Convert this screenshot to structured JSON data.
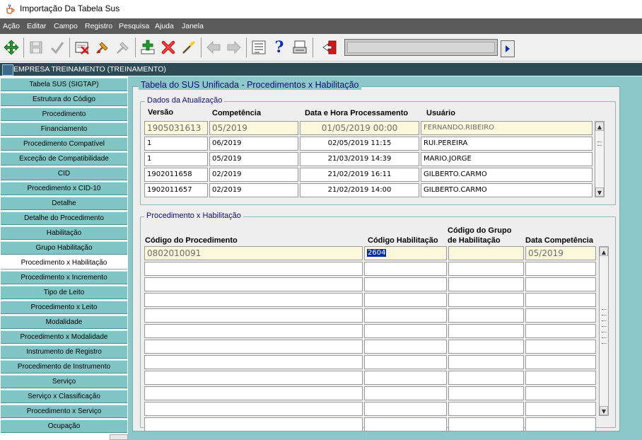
{
  "window": {
    "title": "Importação Da Tabela Sus"
  },
  "menu": [
    "Ação",
    "Editar",
    "Campo",
    "Registro",
    "Pesquisa",
    "Ajuda",
    "Janela"
  ],
  "toolbar": {
    "icons": [
      "enter-query-icon",
      "save-icon",
      "accept-icon",
      "print-icon",
      "clear-icon",
      "clear-field-icon",
      "insert-record-icon",
      "delete-record-icon",
      "duplicate-icon",
      "previous-icon",
      "next-icon",
      "list-icon",
      "help-icon",
      "print-preview-icon",
      "exit-icon",
      "navigate-next-icon"
    ],
    "colors": {
      "green": "#1f9a2a",
      "red": "#d01818",
      "blue": "#1030b0"
    }
  },
  "header": {
    "title": "EMPRESA TREINAMENTO (TREINAMENTO)"
  },
  "sidebar": {
    "active_index": 17,
    "items": [
      "Tabela SUS (SIGTAP)",
      "Estrutura do Código",
      "Procedimento",
      "Financiamento",
      "Procedimento Compatível",
      "Exceção de Compatibilidade",
      "CID",
      "Procedimento x CID-10",
      "Detalhe",
      "Detalhe do Procedimento",
      "Habilitação",
      "Grupo Habilitação",
      "Procedimento x Habilitação",
      "Procedimento x Incremento",
      "Tipo de Leito",
      "Procedimento x Leito",
      "Modalidade",
      "Procedimento x Modalidade",
      "Instrumento de Registro",
      "Procedimento de Instrumento",
      "Serviço",
      "Serviço x Classificação",
      "Procedimento x Serviço",
      "Ocupação"
    ]
  },
  "main": {
    "title": "Tabela do SUS Unificada - Procedimentos x Habilitação",
    "dados": {
      "title": "Dados da Atualização",
      "headers": [
        "Versão",
        "Competência",
        "Data e Hora Processamento",
        "Usuário"
      ],
      "rows": [
        [
          "1905031613",
          "05/2019",
          "01/05/2019 00:00",
          "FERNANDO.RIBEIRO"
        ],
        [
          "1",
          "06/2019",
          "02/05/2019 11:15",
          "RUI.PEREIRA"
        ],
        [
          "1",
          "05/2019",
          "21/03/2019 14:39",
          "MARIO.JORGE"
        ],
        [
          "1902011658",
          "02/2019",
          "21/02/2019 16:11",
          "GILBERTO.CARMO"
        ],
        [
          "1902011657",
          "02/2019",
          "21/02/2019 14:00",
          "GILBERTO.CARMO"
        ]
      ]
    },
    "proc": {
      "title": "Procedimento x Habilitação",
      "headers": {
        "codigo_procedimento": "Código do Procedimento",
        "codigo_habilitacao": "Código Habilitação",
        "grupo_line1": "Código do Grupo",
        "grupo_line2": "de Habilitação",
        "data_competencia": "Data Competência"
      },
      "first_row": {
        "codigo_procedimento": "0802010091",
        "codigo_habilitacao": "2604",
        "grupo": "",
        "data_competencia": "05/2019"
      },
      "empty_rows": 11
    }
  }
}
